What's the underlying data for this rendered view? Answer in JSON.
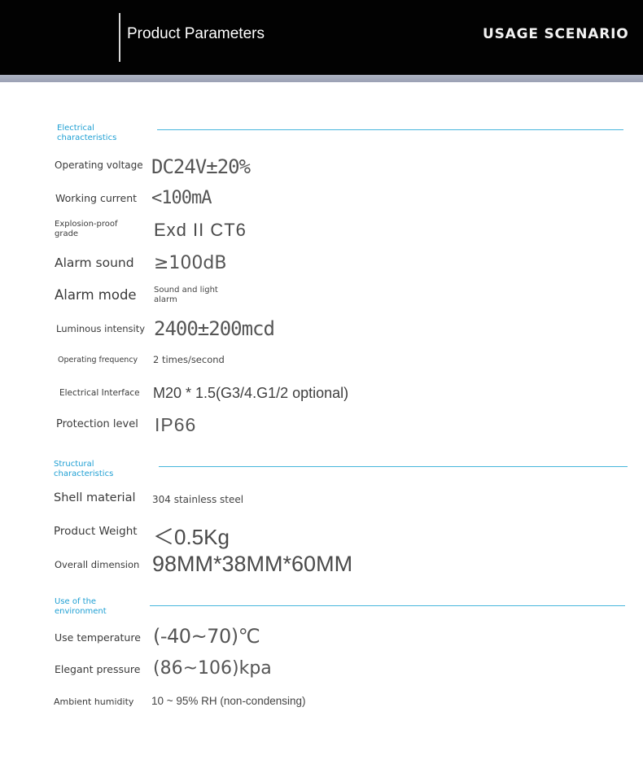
{
  "header": {
    "title": "Product Parameters",
    "usage": "USAGE SCENARIO"
  },
  "sections": {
    "electrical": {
      "title_line1": "Electrical",
      "title_line2": "characteristics",
      "rows": [
        {
          "label": "Operating voltage",
          "value": "DC24V±20%"
        },
        {
          "label": "Working current",
          "value": "<100mA"
        },
        {
          "label_line1": "Explosion-proof",
          "label_line2": "grade",
          "value": "Exd II CT6"
        },
        {
          "label": "Alarm sound",
          "value": "≥100dB"
        },
        {
          "label": "Alarm mode",
          "value_line1": "Sound and light",
          "value_line2": "alarm"
        },
        {
          "label": "Luminous intensity",
          "value": "2400±200mcd"
        },
        {
          "label": "Operating frequency",
          "value": "2 times/second"
        },
        {
          "label": "Electrical Interface",
          "value": "M20 * 1.5(G3/4.G1/2 optional)"
        },
        {
          "label": "Protection level",
          "value": "IP66"
        }
      ]
    },
    "structural": {
      "title_line1": "Structural",
      "title_line2": "characteristics",
      "rows": [
        {
          "label": "Shell material",
          "value": "304 stainless steel"
        },
        {
          "label": "Product Weight",
          "value": "＜0.5Kg"
        },
        {
          "label": "Overall dimension",
          "value": "98MM*38MM*60MM"
        }
      ]
    },
    "environment": {
      "title_line1": "Use of the",
      "title_line2": "environment",
      "rows": [
        {
          "label": "Use temperature",
          "value": "(-40~70)℃"
        },
        {
          "label": "Elegant pressure",
          "value": "(86~106)kpa"
        },
        {
          "label": "Ambient humidity",
          "value": "10 ~ 95% RH (non-condensing)"
        }
      ]
    }
  },
  "colors": {
    "header_bg": "#020202",
    "accent_blue": "#1e9fd3",
    "rule_blue": "#46b6dc"
  }
}
